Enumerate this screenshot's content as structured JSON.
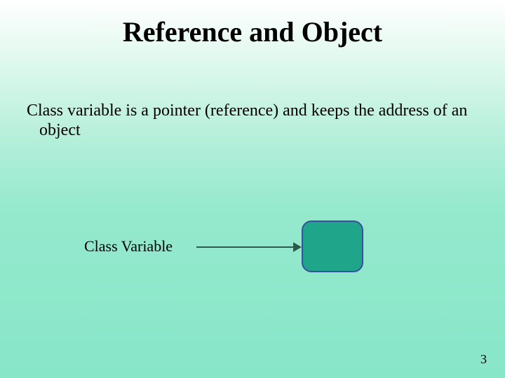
{
  "slide": {
    "title": "Reference and Object",
    "body": "Class variable is a pointer (reference) and keeps the address of an object",
    "diagram": {
      "label": "Class Variable"
    },
    "page_number": "3"
  }
}
